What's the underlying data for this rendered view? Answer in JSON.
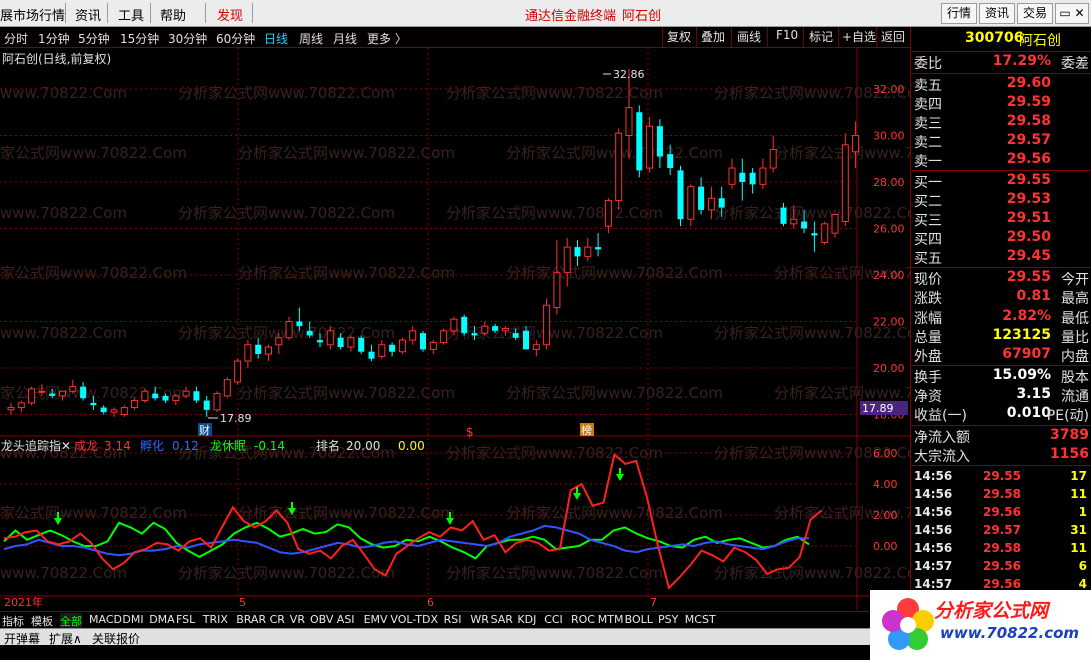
{
  "menu": {
    "items": [
      "展市场行情",
      "资讯",
      "工具",
      "帮助",
      "发现"
    ],
    "center_title": "通达信金融终端",
    "center_stock": "阿石创",
    "right_buttons": [
      "行情",
      "资讯",
      "交易"
    ]
  },
  "periods": {
    "items": [
      "分时",
      "1分钟",
      "5分钟",
      "15分钟",
      "30分钟",
      "60分钟",
      "日线",
      "周线",
      "月线",
      "更多 〉"
    ],
    "active": "日线"
  },
  "toolbar": {
    "items": [
      "复权",
      "叠加",
      "画线",
      "F10",
      "标记",
      "+自选",
      "返回"
    ]
  },
  "chart": {
    "title": "阿石创(日线,前复权)",
    "high_label": "32.86",
    "low_label": "17.89",
    "last_price_box": "17.89",
    "markers": {
      "cai": "财",
      "dollar": "$",
      "bang": "榜"
    },
    "date_labels": {
      "year": "2021年",
      "m5": "5",
      "m6": "6",
      "m7": "7"
    },
    "price_axis": [
      "32.00",
      "30.00",
      "28.00",
      "26.00",
      "24.00",
      "22.00",
      "20.00",
      "18.00"
    ],
    "indicator_axis": [
      "6.00",
      "4.00",
      "2.00",
      "0.00"
    ],
    "watermark": "分析家公式网www.70822.Com",
    "colors": {
      "up": "#ff3030",
      "down": "#00ffff",
      "grid": "#8b0000"
    }
  },
  "chart_data": {
    "type": "candlestick",
    "candles": [
      [
        18.2,
        18.5,
        18.0,
        18.3
      ],
      [
        18.3,
        18.6,
        18.1,
        18.5
      ],
      [
        18.5,
        19.2,
        18.4,
        19.1
      ],
      [
        19.0,
        19.3,
        18.8,
        19.0
      ],
      [
        18.9,
        19.1,
        18.7,
        18.8
      ],
      [
        18.8,
        19.0,
        18.6,
        19.0
      ],
      [
        19.0,
        19.5,
        18.9,
        19.2
      ],
      [
        19.2,
        19.4,
        18.6,
        18.7
      ],
      [
        18.5,
        18.8,
        18.2,
        18.4
      ],
      [
        18.3,
        18.4,
        18.0,
        18.1
      ],
      [
        18.1,
        18.3,
        17.9,
        18.2
      ],
      [
        18.0,
        18.4,
        17.9,
        18.3
      ],
      [
        18.3,
        18.7,
        18.2,
        18.6
      ],
      [
        18.6,
        19.1,
        18.5,
        19.0
      ],
      [
        18.9,
        19.2,
        18.6,
        18.7
      ],
      [
        18.8,
        18.9,
        18.5,
        18.6
      ],
      [
        18.6,
        18.9,
        18.4,
        18.8
      ],
      [
        18.8,
        19.2,
        18.7,
        19.0
      ],
      [
        19.0,
        19.2,
        18.5,
        18.6
      ],
      [
        18.6,
        18.8,
        17.9,
        18.2
      ],
      [
        18.2,
        19.0,
        18.1,
        18.9
      ],
      [
        18.8,
        19.6,
        18.7,
        19.5
      ],
      [
        19.4,
        20.4,
        19.3,
        20.3
      ],
      [
        20.3,
        21.2,
        20.0,
        21.0
      ],
      [
        21.0,
        21.3,
        20.4,
        20.6
      ],
      [
        20.6,
        21.0,
        20.3,
        20.9
      ],
      [
        21.0,
        21.5,
        20.6,
        21.3
      ],
      [
        21.3,
        22.2,
        21.2,
        22.0
      ],
      [
        22.0,
        22.6,
        21.6,
        21.8
      ],
      [
        21.6,
        22.0,
        21.3,
        21.4
      ],
      [
        21.2,
        21.5,
        20.9,
        21.1
      ],
      [
        21.0,
        21.8,
        20.8,
        21.6
      ],
      [
        21.3,
        21.5,
        20.8,
        20.9
      ],
      [
        20.9,
        21.4,
        20.7,
        21.3
      ],
      [
        21.3,
        21.4,
        20.6,
        20.7
      ],
      [
        20.7,
        21.0,
        20.3,
        20.4
      ],
      [
        20.5,
        21.2,
        20.4,
        21.0
      ],
      [
        21.0,
        21.1,
        20.5,
        20.7
      ],
      [
        20.7,
        21.3,
        20.6,
        21.2
      ],
      [
        21.2,
        21.8,
        21.0,
        21.6
      ],
      [
        21.5,
        21.6,
        20.7,
        20.8
      ],
      [
        20.8,
        21.2,
        20.6,
        21.1
      ],
      [
        21.1,
        21.7,
        21.0,
        21.6
      ],
      [
        21.6,
        22.2,
        21.4,
        22.1
      ],
      [
        22.2,
        22.3,
        21.4,
        21.5
      ],
      [
        21.5,
        21.8,
        21.2,
        21.4
      ],
      [
        21.5,
        22.0,
        21.4,
        21.8
      ],
      [
        21.8,
        21.9,
        21.5,
        21.6
      ],
      [
        21.6,
        21.8,
        21.4,
        21.7
      ],
      [
        21.5,
        21.7,
        21.2,
        21.3
      ],
      [
        21.6,
        21.8,
        21.0,
        20.8
      ],
      [
        20.8,
        21.2,
        20.5,
        21.0
      ],
      [
        21.0,
        23.0,
        20.8,
        22.7
      ],
      [
        22.6,
        25.5,
        22.3,
        24.1
      ],
      [
        24.1,
        25.6,
        23.5,
        25.2
      ],
      [
        25.2,
        25.5,
        24.4,
        24.8
      ],
      [
        24.8,
        25.6,
        24.6,
        25.2
      ],
      [
        25.2,
        25.8,
        24.8,
        25.1
      ],
      [
        26.1,
        27.3,
        25.8,
        27.2
      ],
      [
        27.2,
        30.3,
        26.8,
        30.1
      ],
      [
        30.0,
        32.86,
        29.0,
        31.2
      ],
      [
        31.0,
        31.3,
        28.2,
        28.5
      ],
      [
        28.6,
        30.8,
        28.4,
        30.4
      ],
      [
        30.4,
        30.7,
        28.6,
        29.1
      ],
      [
        29.2,
        29.6,
        28.3,
        28.6
      ],
      [
        28.5,
        28.7,
        26.1,
        26.4
      ],
      [
        26.4,
        27.9,
        26.1,
        27.8
      ],
      [
        27.8,
        28.2,
        26.6,
        26.8
      ],
      [
        26.8,
        27.8,
        26.4,
        27.3
      ],
      [
        27.3,
        27.8,
        26.5,
        26.9
      ],
      [
        27.9,
        29.0,
        27.7,
        28.6
      ],
      [
        28.4,
        29.0,
        27.2,
        28.0
      ],
      [
        28.4,
        28.6,
        27.5,
        27.9
      ],
      [
        27.9,
        29.0,
        27.7,
        28.6
      ],
      [
        28.6,
        30.0,
        28.4,
        29.4
      ],
      [
        26.9,
        27.1,
        26.1,
        26.2
      ],
      [
        26.2,
        27.0,
        26.0,
        26.4
      ],
      [
        26.3,
        26.8,
        25.8,
        26.0
      ],
      [
        25.8,
        26.3,
        25.0,
        25.7
      ],
      [
        25.4,
        26.3,
        25.3,
        26.2
      ],
      [
        25.8,
        26.5,
        25.6,
        26.6
      ],
      [
        26.3,
        30.1,
        26.1,
        29.6
      ],
      [
        29.3,
        30.6,
        28.6,
        30.0
      ]
    ],
    "indicator": {
      "name": "龙头追踪指",
      "series": [
        {
          "name": "成龙",
          "value_label": "3.14"
        },
        {
          "name": "孵化",
          "value_label": "0.12"
        },
        {
          "name": "龙休眠",
          "value_label": "-0.14"
        },
        {
          "name": "排名",
          "value_label": "20.00"
        },
        {
          "name": "",
          "value_label": "0.00"
        }
      ],
      "red": [
        0.5,
        0.6,
        0.9,
        1.0,
        0.3,
        0.1,
        0.3,
        0.8,
        0.2,
        -0.8,
        -1.5,
        -1.1,
        -0.4,
        -0.2,
        0.2,
        0.1,
        -0.3,
        0.3,
        0.5,
        -0.1,
        1.2,
        2.5,
        1.6,
        1.2,
        1.6,
        2.3,
        1.5,
        -0.2,
        -0.5,
        -0.3,
        -0.8,
        0.0,
        0.4,
        -0.5,
        -1.5,
        -1.9,
        -0.5,
        0.0,
        0.5,
        0.9,
        0.6,
        1.2,
        1.0,
        1.6,
        0.4,
        0.7,
        -0.4,
        0.2,
        0.4,
        0.2,
        -0.3,
        -0.2,
        3.6,
        4.0,
        2.6,
        2.8,
        5.9,
        5.3,
        5.5,
        3.1,
        0.0,
        -2.7,
        -2.0,
        -1.2,
        -0.3,
        -0.6,
        -1.0,
        -0.1,
        -0.4,
        -0.9,
        -1.8,
        -1.5,
        -1.4,
        -0.7,
        1.7,
        2.3
      ],
      "blue": [
        -0.2,
        0.0,
        0.1,
        0.4,
        0.2,
        0.0,
        0.0,
        -0.1,
        -0.3,
        -0.5,
        -0.6,
        -0.5,
        -0.3,
        -0.3,
        -0.2,
        0.0,
        -0.1,
        0.1,
        0.2,
        0.3,
        0.4,
        0.3,
        0.2,
        -0.1,
        -0.4,
        -0.5,
        -0.4,
        -0.2,
        0.0,
        0.2,
        0.1,
        -0.1,
        0.0,
        0.2,
        0.3,
        0.1,
        0.0,
        0.2,
        0.4,
        0.3,
        0.2,
        0.1,
        0.0,
        0.2,
        0.6,
        0.8,
        1.0,
        1.3,
        1.2,
        1.0,
        0.8,
        0.4,
        0.2,
        0.0,
        -0.3,
        -0.4,
        -0.2,
        -0.1,
        0.0,
        0.1,
        0.0,
        0.2,
        0.3,
        0.1,
        0.0,
        -0.1,
        -0.2,
        0.0,
        0.3,
        0.5,
        0.5
      ],
      "green": [
        0.3,
        1.0,
        0.4,
        0.7,
        1.0,
        0.7,
        0.3,
        0.0,
        0.0,
        0.3,
        1.5,
        1.2,
        0.8,
        1.5,
        1.1,
        0.2,
        -0.3,
        -0.7,
        -0.3,
        0.1,
        0.8,
        1.2,
        1.5,
        1.1,
        0.6,
        0.8,
        1.1,
        0.8,
        0.9,
        1.4,
        1.2,
        0.5,
        0.1,
        -0.1,
        0.0,
        0.4,
        0.3,
        0.6,
        0.3,
        -0.1,
        -0.4,
        -0.8,
        0.0,
        0.2,
        0.4,
        0.4,
        0.6,
        0.4,
        -0.2,
        -0.1,
        0.0,
        0.4,
        0.4,
        1.0,
        1.2,
        0.8,
        0.5,
        0.3,
        0.0,
        -0.1,
        0.4,
        0.6,
        0.2,
        0.4,
        0.5,
        0.2,
        -0.1,
        0.0,
        0.4,
        0.6,
        0.1
      ]
    }
  },
  "quote": {
    "code": "300706",
    "name": "阿石创",
    "webi_label": "委比",
    "webi_value": "17.29%",
    "webi_right": "委差",
    "asks": [
      {
        "label": "卖五",
        "price": "29.60"
      },
      {
        "label": "卖四",
        "price": "29.59"
      },
      {
        "label": "卖三",
        "price": "29.58"
      },
      {
        "label": "卖二",
        "price": "29.57"
      },
      {
        "label": "卖一",
        "price": "29.56"
      }
    ],
    "bids": [
      {
        "label": "买一",
        "price": "29.55"
      },
      {
        "label": "买二",
        "price": "29.53"
      },
      {
        "label": "买三",
        "price": "29.51"
      },
      {
        "label": "买四",
        "price": "29.50"
      },
      {
        "label": "买五",
        "price": "29.45"
      }
    ],
    "stats": [
      {
        "label": "现价",
        "value": "29.55",
        "right": "今开",
        "color": "red"
      },
      {
        "label": "涨跌",
        "value": "0.81",
        "right": "最高",
        "color": "red"
      },
      {
        "label": "涨幅",
        "value": "2.82%",
        "right": "最低",
        "color": "red"
      },
      {
        "label": "总量",
        "value": "123125",
        "right": "量比",
        "color": "yel"
      },
      {
        "label": "外盘",
        "value": "67907",
        "right": "内盘",
        "color": "red"
      }
    ],
    "stats2": [
      {
        "label": "换手",
        "value": "15.09%",
        "right": "股本"
      },
      {
        "label": "净资",
        "value": "3.15",
        "right": "流通"
      },
      {
        "label": "收益(一)",
        "value": "0.010",
        "right": "PE(动)"
      }
    ],
    "flow": [
      {
        "label": "净流入额",
        "value": "3789"
      },
      {
        "label": "大宗流入",
        "value": "1156"
      }
    ],
    "ticks": [
      {
        "time": "14:56",
        "price": "29.55",
        "vol": "17"
      },
      {
        "time": "14:56",
        "price": "29.58",
        "vol": "11"
      },
      {
        "time": "14:56",
        "price": "29.56",
        "vol": "1"
      },
      {
        "time": "14:56",
        "price": "29.57",
        "vol": "31"
      },
      {
        "time": "14:56",
        "price": "29.58",
        "vol": "11"
      },
      {
        "time": "14:57",
        "price": "29.56",
        "vol": "6"
      },
      {
        "time": "14:57",
        "price": "29.56",
        "vol": "4"
      }
    ]
  },
  "tabs": {
    "items": [
      "指标",
      "模板",
      "全部",
      "MACD",
      "DMI",
      "DMA",
      "FSL",
      "TRIX",
      "BRAR",
      "CR",
      "VR",
      "OBV",
      "ASI",
      "EMV",
      "VOL-TDX",
      "RSI",
      "WR",
      "SAR",
      "KDJ",
      "CCI",
      "ROC",
      "MTM",
      "BOLL",
      "PSY",
      "MCST"
    ],
    "active": "全部"
  },
  "status": {
    "items": [
      "开弹幕",
      "扩展∧",
      "关联报价"
    ]
  },
  "logo": {
    "text": "分析家公式网",
    "url": "www.70822.com"
  }
}
